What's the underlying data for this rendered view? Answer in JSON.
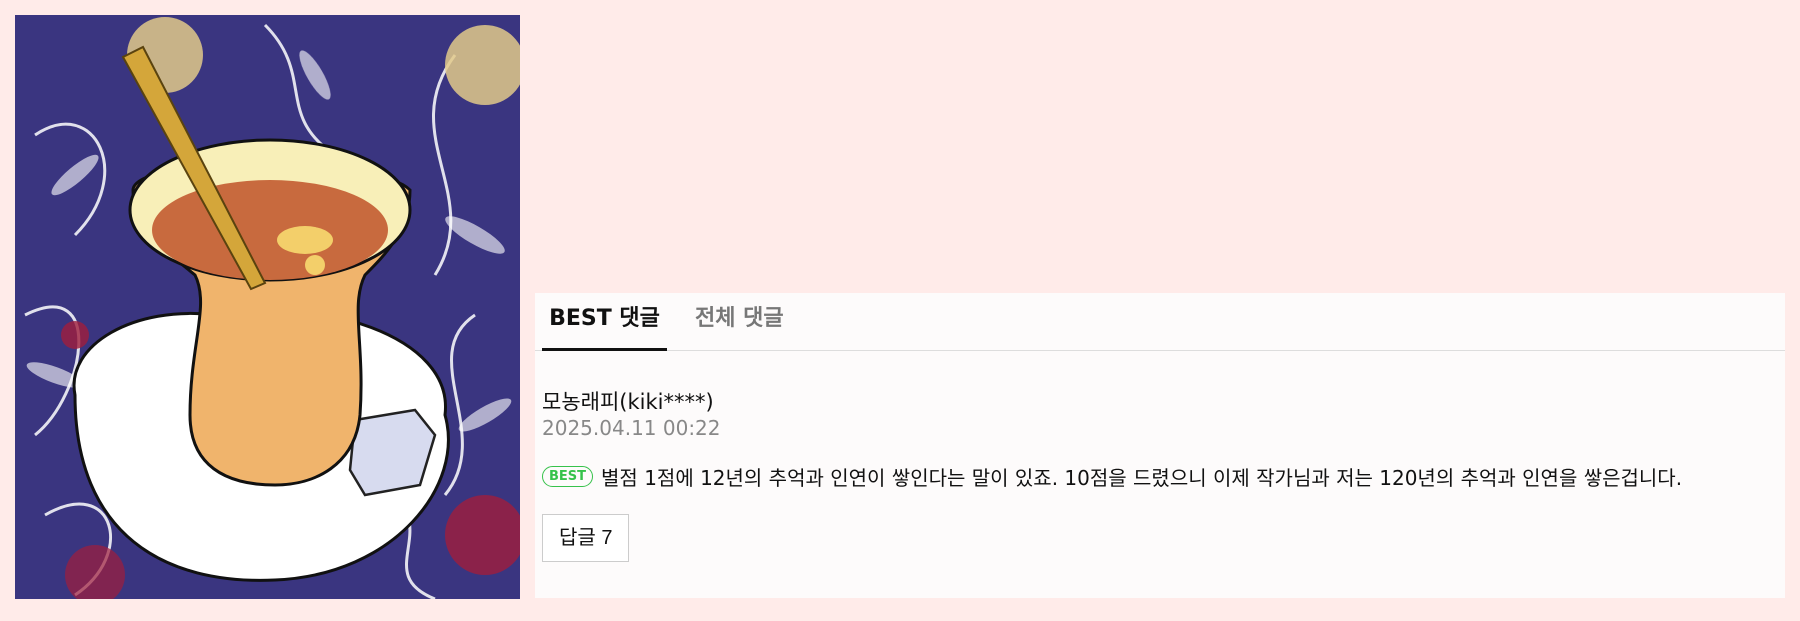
{
  "artwork": {
    "icon": "tea-glass-illustration",
    "colors": {
      "background": "#3a3580",
      "saucer": "#ffffff",
      "tea": "#c86a3e",
      "glass": "#f0b46c"
    }
  },
  "tabs": [
    {
      "label": "BEST 댓글",
      "active": true
    },
    {
      "label": "전체 댓글",
      "active": false
    }
  ],
  "comment": {
    "author": "모농래피(kiki****)",
    "date": "2025.04.11 00:22",
    "badge": "BEST",
    "text": "별점 1점에 12년의 추억과 인연이 쌓인다는 말이 있죠. 10점을 드렸으니 이제 작가님과 저는 120년의 추억과 인연을 쌓은겁니다.",
    "reply_label": "답글 7"
  },
  "colors": {
    "page_bg": "#ffebe9",
    "badge": "#37c24b"
  }
}
